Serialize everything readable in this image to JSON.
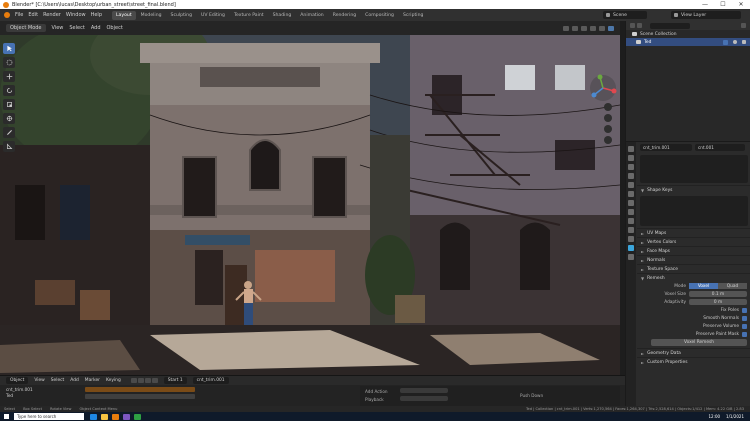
{
  "window": {
    "title": "Blender* [C:\\Users\\lucas\\Desktop\\urban_street\\street_final.blend]",
    "minimize": "—",
    "maximize": "☐",
    "close": "✕"
  },
  "menu": [
    "File",
    "Edit",
    "Render",
    "Window",
    "Help"
  ],
  "workspaces": [
    {
      "label": "Layout",
      "active": true
    },
    {
      "label": "Modeling",
      "active": false
    },
    {
      "label": "Sculpting",
      "active": false
    },
    {
      "label": "UV Editing",
      "active": false
    },
    {
      "label": "Texture Paint",
      "active": false
    },
    {
      "label": "Shading",
      "active": false
    },
    {
      "label": "Animation",
      "active": false
    },
    {
      "label": "Rendering",
      "active": false
    },
    {
      "label": "Compositing",
      "active": false
    },
    {
      "label": "Scripting",
      "active": false
    }
  ],
  "scene": {
    "name": "Scene"
  },
  "view_layer": {
    "name": "View Layer"
  },
  "viewport_header": {
    "mode": "Object Mode",
    "menus": [
      "View",
      "Select",
      "Add",
      "Object"
    ]
  },
  "tools": [
    "cursor-tool",
    "select-box-tool",
    "move-tool",
    "rotate-tool",
    "scale-tool",
    "transform-tool",
    "annotate-tool",
    "measure-tool"
  ],
  "outliner": {
    "rows": [
      {
        "label": "Scene Collection",
        "selected": false,
        "indent": 0
      },
      {
        "label": "Ted",
        "selected": true,
        "indent": 1
      }
    ]
  },
  "properties": {
    "object_field": "cnt_trim.001",
    "data_field": "cnt.001",
    "panels": [
      {
        "label": "Shape Keys",
        "open": true
      },
      {
        "label": "UV Maps",
        "open": false
      },
      {
        "label": "Vertex Colors",
        "open": false
      },
      {
        "label": "Face Maps",
        "open": false
      },
      {
        "label": "Normals",
        "open": false
      },
      {
        "label": "Texture Space",
        "open": false
      },
      {
        "label": "Remesh",
        "open": true
      }
    ],
    "remesh": {
      "mode_label": "Mode",
      "modes": [
        {
          "label": "Voxel",
          "on": true
        },
        {
          "label": "Quad",
          "on": false
        }
      ],
      "voxel_size_label": "Voxel Size",
      "voxel_size": "0.1 m",
      "adaptivity_label": "Adaptivity",
      "adaptivity": "0 m",
      "checks": [
        "Fix Poles",
        "Smooth Normals",
        "Preserve Volume",
        "Preserve Paint Mask"
      ],
      "button": "Voxel Remesh"
    },
    "more_panels": [
      "Geometry Data",
      "Custom Properties"
    ]
  },
  "timeline": {
    "header": [
      "Object",
      "View",
      "Select",
      "Add",
      "Marker"
    ],
    "keying": "Keying",
    "frame_label": "Start 1",
    "action": "cnt_trim.001",
    "tracks": [
      "cnt_trim.001",
      "Ted"
    ],
    "right_labels": [
      "Add Action",
      "Playback",
      "Push Down"
    ]
  },
  "statusbar": {
    "left": [
      "Select",
      "Box Select",
      "Rotate View",
      "Object Context Menu"
    ],
    "stats": "Ted | Collection | cnt_trim.001 | Verts:1,270,564 | Faces:1,264,307 | Tris:2,528,614 | Objects:1/412 | Mem: 4.22 GiB | 2.83"
  },
  "taskbar": {
    "search": "Type here to search",
    "time": "12:00",
    "date": "1/1/2021"
  },
  "colors": {
    "accent": "#4772b3",
    "orange": "#e87d0d",
    "selected_row": "#334d80"
  }
}
